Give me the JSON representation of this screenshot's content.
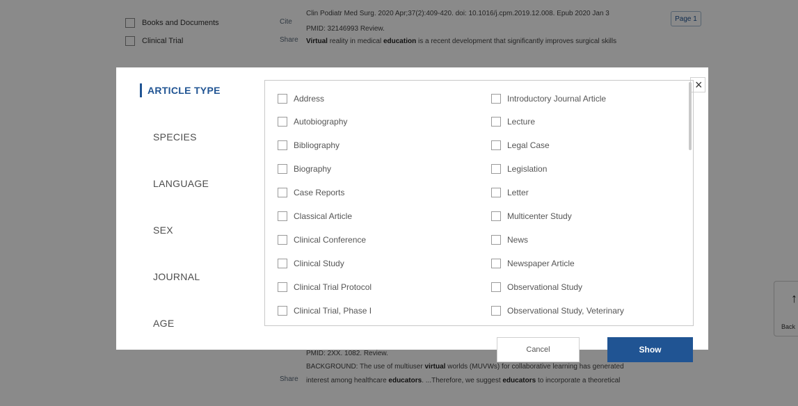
{
  "background": {
    "filters": [
      "Books and Documents",
      "Clinical Trial"
    ],
    "side_labels": [
      "Cite",
      "Share",
      "Share"
    ],
    "top_lines": [
      "Clin Podiatr Med Surg. 2020 Apr;37(2):409-420. doi: 10.1016/j.cpm.2019.12.008. Epub 2020 Jan 3",
      "PMID: 32146993   Review."
    ],
    "top_snippet": {
      "t1": "Virtual",
      "t2": " reality in medical ",
      "t3": "education",
      "t4": " is a recent development that significantly improves surgical skills"
    },
    "bottom_lines": [
      "PMID: 2XX. 1082.    Review."
    ],
    "bottom_snippet_1": {
      "t1": "BACKGROUND: The use of multiuser ",
      "t2": "virtual",
      "t3": " worlds (MUVWs) for collaborative learning has generated"
    },
    "bottom_snippet_2": {
      "t1": "interest among healthcare ",
      "t2": "educators",
      "t3": ". ...Therefore, we suggest ",
      "t4": "educators",
      "t5": " to incorporate a theoretical"
    },
    "page_tag": "Page 1",
    "back_label": "Back",
    "back_arrow": "↑"
  },
  "modal": {
    "close_symbol": "×",
    "categories": [
      {
        "label": "ARTICLE TYPE",
        "active": true
      },
      {
        "label": "SPECIES",
        "active": false
      },
      {
        "label": "LANGUAGE",
        "active": false
      },
      {
        "label": "SEX",
        "active": false
      },
      {
        "label": "JOURNAL",
        "active": false
      },
      {
        "label": "AGE",
        "active": false
      }
    ],
    "options_left": [
      "Address",
      "Autobiography",
      "Bibliography",
      "Biography",
      "Case Reports",
      "Classical Article",
      "Clinical Conference",
      "Clinical Study",
      "Clinical Trial Protocol",
      "Clinical Trial, Phase I"
    ],
    "options_right": [
      "Introductory Journal Article",
      "Lecture",
      "Legal Case",
      "Legislation",
      "Letter",
      "Multicenter Study",
      "News",
      "Newspaper Article",
      "Observational Study",
      "Observational Study, Veterinary"
    ],
    "cancel_label": "Cancel",
    "show_label": "Show"
  },
  "colors": {
    "accent": "#205493",
    "overlay": "rgba(0,0,0,0.46)"
  }
}
